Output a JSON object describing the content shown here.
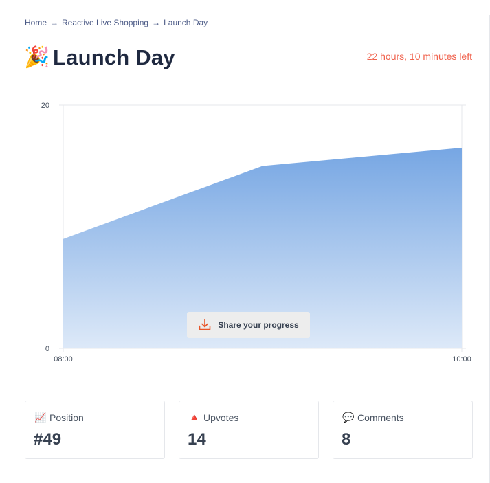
{
  "breadcrumb": {
    "items": [
      "Home",
      "Reactive Live Shopping"
    ],
    "separator": "→",
    "current": "Launch Day"
  },
  "header": {
    "emoji": "🎉",
    "title": "Launch Day",
    "time_left": "22 hours, 10 minutes left"
  },
  "chart_data": {
    "type": "area",
    "x": [
      "08:00",
      "09:00",
      "10:00"
    ],
    "y": [
      9,
      15,
      16.5
    ],
    "ylim": [
      0,
      20
    ],
    "yticks": [
      0,
      20
    ],
    "xticks": [
      "08:00",
      "10:00"
    ],
    "colors": {
      "fill_top": "#76a6e3",
      "fill_bottom": "#dde9f8",
      "gridline": "#e5e7eb"
    }
  },
  "share_button": {
    "label": "Share your progress",
    "icon": "download-icon",
    "icon_color": "#e8562a"
  },
  "stats": [
    {
      "emoji": "📈",
      "label": "Position",
      "value": "#49"
    },
    {
      "emoji": "🔺",
      "label": "Upvotes",
      "value": "14"
    },
    {
      "emoji": "💬",
      "label": "Comments",
      "value": "8"
    }
  ]
}
